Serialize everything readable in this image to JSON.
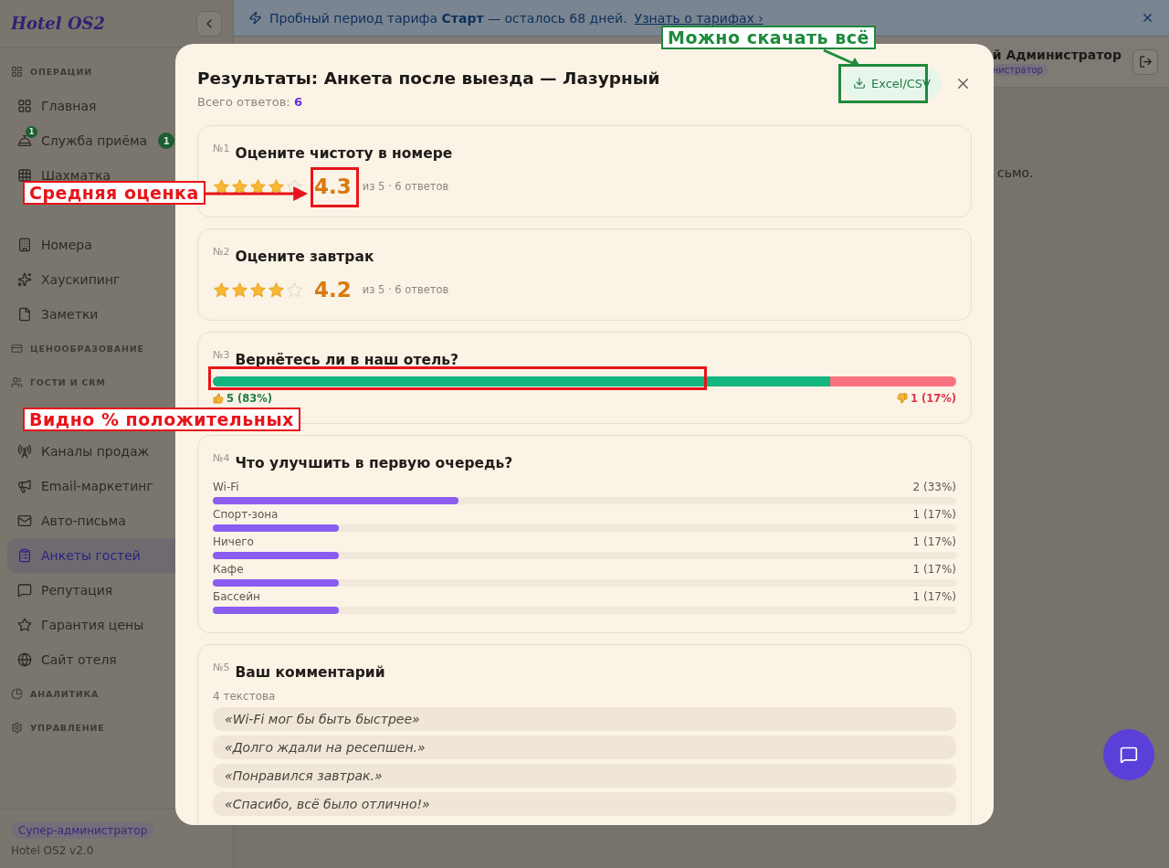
{
  "sidebar": {
    "logo": "Hotel OS2",
    "sections": [
      {
        "title": "ОПЕРАЦИИ",
        "items": [
          {
            "label": "Главная",
            "selected": false
          },
          {
            "label": "Служба приёма",
            "selected": false,
            "icon_badge": "1",
            "badge": "1"
          },
          {
            "label": "Шахматка",
            "selected": false
          },
          {
            "kind": "hidden"
          },
          {
            "label": "Номера",
            "selected": false
          },
          {
            "label": "Хаускипинг",
            "selected": false
          },
          {
            "label": "Заметки",
            "selected": false
          }
        ]
      },
      {
        "title": "ЦЕНООБРАЗОВАНИЕ"
      },
      {
        "title": "ГОСТИ И CRM",
        "items": [
          {
            "kind": "hidden"
          },
          {
            "label": "Каналы продаж",
            "selected": false
          },
          {
            "label": "Email-маркетинг",
            "selected": false
          },
          {
            "label": "Авто-письма",
            "selected": false
          },
          {
            "label": "Анкеты гостей",
            "selected": true
          },
          {
            "label": "Репутация",
            "selected": false
          },
          {
            "label": "Гарантия цены",
            "selected": false
          },
          {
            "label": "Сайт отеля",
            "selected": false
          }
        ]
      },
      {
        "title": "АНАЛИТИКА"
      },
      {
        "title": "УПРАВЛЕНИЕ"
      }
    ],
    "role": "Супер-администратор",
    "version": "Hotel OS2 v2.0"
  },
  "banner": {
    "text": "Пробный период тарифа **Старт** — осталось 68 дней.",
    "link": "Узнать о тарифах ›"
  },
  "topbar": {
    "user": "й Администратор",
    "role": "нистратор"
  },
  "content_text": "сьмо.",
  "modal": {
    "title": "Результаты: Анкета после выезда — Лазурный",
    "total_label": "Всего ответов:",
    "total": "6",
    "export": "Excel/CSV",
    "questions": [
      {
        "kind": "rating",
        "number": "№1",
        "title": "Оцените чистоту в номере",
        "stars": 4,
        "score": "4.3",
        "meta": "из 5 · 6 ответов"
      },
      {
        "kind": "rating",
        "number": "№2",
        "title": "Оцените завтрак",
        "stars": 4,
        "score": "4.2",
        "meta": "из 5 · 6 ответов"
      },
      {
        "kind": "yesno",
        "number": "№3",
        "title": "Вернётесь ли в наш отель?",
        "yes": {
          "text": "5 (83%)",
          "level": 0.83
        },
        "no": {
          "text": "1 (17%)"
        }
      },
      {
        "kind": "choice",
        "number": "№4",
        "title": "Что улучшить в первую очередь?",
        "options": [
          {
            "label": "Wi-Fi",
            "count": "2 (33%)",
            "level": 0.33
          },
          {
            "label": "Спорт-зона",
            "count": "1 (17%)",
            "level": 0.17
          },
          {
            "label": "Ничего",
            "count": "1 (17%)",
            "level": 0.17
          },
          {
            "label": "Кафе",
            "count": "1 (17%)",
            "level": 0.17
          },
          {
            "label": "Бассейн",
            "count": "1 (17%)",
            "level": 0.17
          }
        ]
      },
      {
        "kind": "text",
        "number": "№5",
        "title": "Ваш комментарий",
        "count": "4 текстова",
        "answers": [
          "«Wi-Fi мог бы быть быстрее»",
          "«Долго ждали на ресепшен.»",
          "«Понравился завтрак.»",
          "«Спасибо, всё было отлично!»"
        ]
      }
    ]
  },
  "annotations": [
    {
      "kind": "download",
      "text": "Можно скачать всё",
      "color": "#1e8a3c"
    },
    {
      "kind": "average",
      "text": "Средняя оценка",
      "color": "#e8141a"
    },
    {
      "kind": "positive",
      "text": "Видно % положительных",
      "color": "#e8141a"
    }
  ]
}
